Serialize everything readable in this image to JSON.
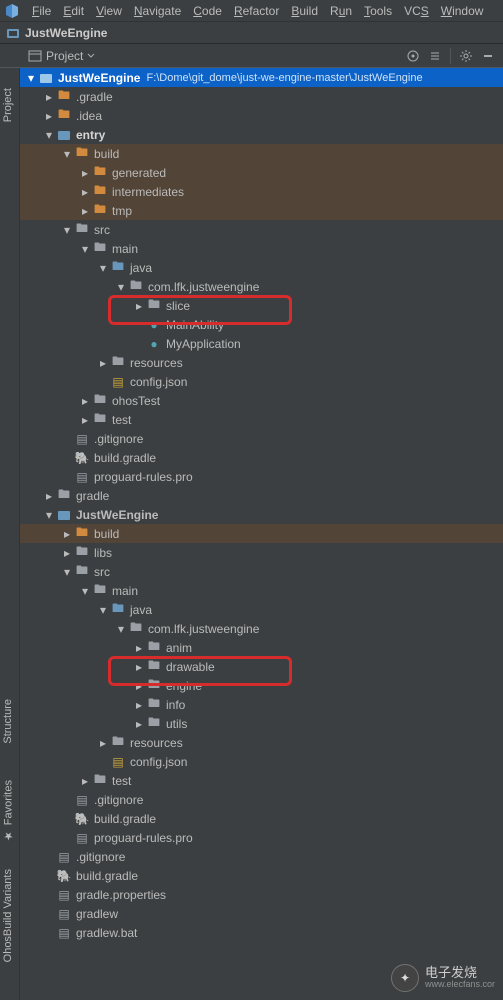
{
  "menu": {
    "items": [
      "File",
      "Edit",
      "View",
      "Navigate",
      "Code",
      "Refactor",
      "Build",
      "Run",
      "Tools",
      "VCS",
      "Window"
    ]
  },
  "titlebar": {
    "project": "JustWeEngine"
  },
  "toolbar": {
    "view_label": "Project"
  },
  "root": {
    "name": "JustWeEngine",
    "path": "F:\\Dome\\git_dome\\just-we-engine-master\\JustWeEngine"
  },
  "tree": {
    "gradle_dir": ".gradle",
    "idea_dir": ".idea",
    "entry": "entry",
    "build": "build",
    "generated": "generated",
    "intermediates": "intermediates",
    "tmp": "tmp",
    "src": "src",
    "main": "main",
    "java": "java",
    "package": "com.lfk.justweengine",
    "slice": "slice",
    "main_ability": "MainAbility",
    "my_application": "MyApplication",
    "resources": "resources",
    "config_json": "config.json",
    "ohos_test": "ohosTest",
    "test": "test",
    "gitignore": ".gitignore",
    "build_gradle": "build.gradle",
    "proguard": "proguard-rules.pro",
    "gradle": "gradle",
    "module_name": "JustWeEngine",
    "libs": "libs",
    "anim": "anim",
    "drawable": "drawable",
    "engine": "engine",
    "info": "info",
    "utils": "utils",
    "gradle_properties": "gradle.properties",
    "gradlew": "gradlew",
    "gradlew_bat": "gradlew.bat"
  },
  "sidebar": {
    "project": "Project",
    "structure": "Structure",
    "favorites": "Favorites",
    "ohos": "OhosBuild Variants"
  },
  "watermark": {
    "brand": "电子发烧",
    "url": "www.elecfans.cor"
  }
}
